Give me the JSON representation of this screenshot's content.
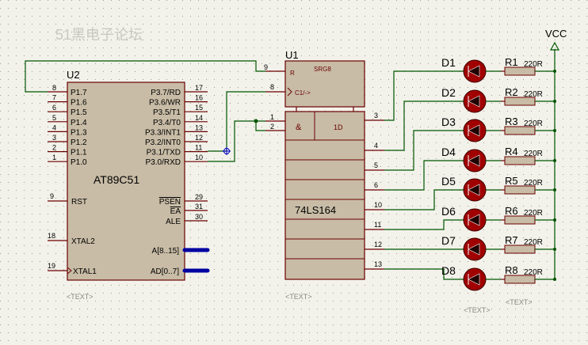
{
  "watermark": "51黑电子论坛",
  "vcc_label": "VCC",
  "u2": {
    "ref": "U2",
    "part": "AT89C51",
    "text_tag": "<TEXT>",
    "left_pins": [
      {
        "num": "8",
        "name": "P1.7"
      },
      {
        "num": "7",
        "name": "P1.6"
      },
      {
        "num": "6",
        "name": "P1.5"
      },
      {
        "num": "5",
        "name": "P1.4"
      },
      {
        "num": "4",
        "name": "P1.3"
      },
      {
        "num": "3",
        "name": "P1.2"
      },
      {
        "num": "2",
        "name": "P1.1"
      },
      {
        "num": "1",
        "name": "P1.0"
      }
    ],
    "right_pins": [
      {
        "num": "17",
        "name": "P3.7/RD"
      },
      {
        "num": "16",
        "name": "P3.6/WR"
      },
      {
        "num": "15",
        "name": "P3.5/T1"
      },
      {
        "num": "14",
        "name": "P3.4/T0"
      },
      {
        "num": "13",
        "name": "P3.3/INT1"
      },
      {
        "num": "12",
        "name": "P3.2/INT0"
      },
      {
        "num": "11",
        "name": "P3.1/TXD"
      },
      {
        "num": "10",
        "name": "P3.0/RXD"
      }
    ],
    "rst": {
      "num": "9",
      "name": "RST"
    },
    "ctrl_pins": [
      {
        "num": "29",
        "name": "PSEN"
      },
      {
        "num": "31",
        "name": "EA"
      },
      {
        "num": "30",
        "name": "ALE"
      }
    ],
    "xtal2": {
      "num": "18",
      "name": "XTAL2"
    },
    "xtal1": {
      "num": "19",
      "name": "XTAL1"
    },
    "bus_a": "A[8..15]",
    "bus_ad": "AD[0..7]"
  },
  "u1": {
    "ref": "U1",
    "part": "74LS164",
    "title": "SRG8",
    "text_tag": "<TEXT>",
    "pin_r": {
      "num": "9",
      "name": "R"
    },
    "pin_clk": {
      "num": "8",
      "name": "C1/->"
    },
    "pin_a": {
      "num": "1"
    },
    "pin_b": {
      "num": "2"
    },
    "and_label": "&",
    "d_label": "1D",
    "outputs": [
      "3",
      "4",
      "5",
      "6",
      "10",
      "11",
      "12",
      "13"
    ]
  },
  "leds": [
    "D1",
    "D2",
    "D3",
    "D4",
    "D5",
    "D6",
    "D7",
    "D8"
  ],
  "resistors": [
    {
      "ref": "R1",
      "value": "220R"
    },
    {
      "ref": "R2",
      "value": "220R"
    },
    {
      "ref": "R3",
      "value": "220R"
    },
    {
      "ref": "R4",
      "value": "220R"
    },
    {
      "ref": "R5",
      "value": "220R"
    },
    {
      "ref": "R6",
      "value": "220R"
    },
    {
      "ref": "R7",
      "value": "220R"
    },
    {
      "ref": "R8",
      "value": "220R"
    }
  ],
  "text_tags": {
    "leds": "<TEXT>",
    "resistors": "<TEXT>"
  }
}
